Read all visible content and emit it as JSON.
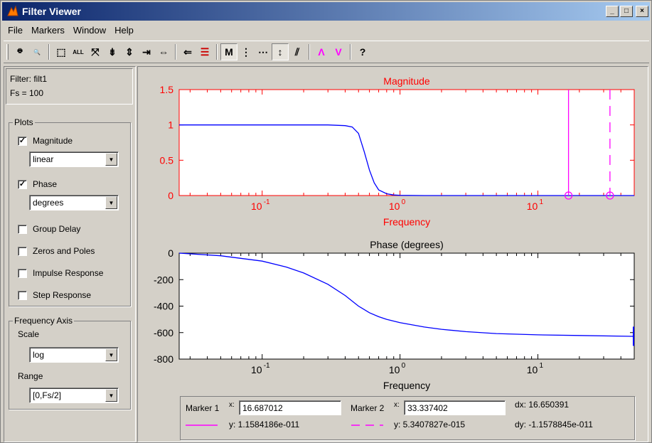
{
  "window": {
    "title": "Filter Viewer",
    "minimize": "_",
    "maximize": "□",
    "close": "×"
  },
  "menu": [
    "File",
    "Markers",
    "Window",
    "Help"
  ],
  "toolbar": {
    "tools": [
      {
        "id": "print-icon",
        "glyph": "🖶",
        "pressed": false
      },
      {
        "id": "print-preview-icon",
        "glyph": "🔍",
        "pressed": false
      },
      {
        "sep": true
      },
      {
        "id": "zoom-box-icon",
        "glyph": "⬚",
        "pressed": false
      },
      {
        "id": "zoom-all-icon",
        "glyph": "ALL",
        "pressed": false
      },
      {
        "id": "zoom-out-icon",
        "glyph": "⤧",
        "pressed": false
      },
      {
        "id": "zoom-y-in-icon",
        "glyph": "⇟",
        "pressed": false
      },
      {
        "id": "zoom-y-out-icon",
        "glyph": "⇕",
        "pressed": false
      },
      {
        "id": "zoom-x-in-icon",
        "glyph": "⇥",
        "pressed": false
      },
      {
        "id": "zoom-x-out-icon",
        "glyph": "⇔",
        "pressed": false
      },
      {
        "sep": true
      },
      {
        "id": "pass-band-icon",
        "glyph": "⇐",
        "pressed": false
      },
      {
        "id": "line-style-icon",
        "glyph": "☰",
        "pressed": false
      },
      {
        "sep": true
      },
      {
        "id": "markers-on-icon",
        "glyph": "M",
        "pressed": true
      },
      {
        "id": "vertical-markers-icon",
        "glyph": "⋮",
        "pressed": false
      },
      {
        "id": "horizontal-markers-icon",
        "glyph": "⋯",
        "pressed": false
      },
      {
        "id": "track-marker-icon",
        "glyph": "↕",
        "pressed": true
      },
      {
        "id": "slope-marker-icon",
        "glyph": "⫽",
        "pressed": false
      },
      {
        "sep": true
      },
      {
        "id": "peaks-icon",
        "glyph": "Λ",
        "pressed": false
      },
      {
        "id": "valleys-icon",
        "glyph": "V",
        "pressed": false
      },
      {
        "sep": true
      },
      {
        "id": "whats-this-help-icon",
        "glyph": "?",
        "pressed": false
      }
    ]
  },
  "filter": {
    "label": "Filter: filt1",
    "fs": "Fs = 100"
  },
  "plots": {
    "title": "Plots",
    "magnitude": {
      "label": "Magnitude",
      "checked": true,
      "scale": "linear"
    },
    "phase": {
      "label": "Phase",
      "checked": true,
      "units": "degrees"
    },
    "group_delay": {
      "label": "Group Delay",
      "checked": false
    },
    "zeros_poles": {
      "label": "Zeros and Poles",
      "checked": false
    },
    "impulse": {
      "label": "Impulse Response",
      "checked": false
    },
    "step": {
      "label": "Step Response",
      "checked": false
    }
  },
  "freq_axis": {
    "title": "Frequency Axis",
    "scale_label": "Scale",
    "scale": "log",
    "range_label": "Range",
    "range": "[0,Fs/2]"
  },
  "markers": {
    "m1_label": "Marker 1",
    "m2_label": "Marker 2",
    "x_label": "x:",
    "m1_x": "16.687012",
    "m2_x": "33.337402",
    "m1_y": "y: 1.1584186e-011",
    "m2_y": "y: 5.3407827e-015",
    "dx": "dx: 16.650391",
    "dy": "dy: -1.1578845e-011",
    "m1_color": "#ff00ff",
    "m2_color": "#ff00ff"
  },
  "chart_data": [
    {
      "type": "line",
      "title": "Magnitude",
      "xlabel": "Frequency",
      "ylabel": "",
      "xscale": "log",
      "xlim": [
        0.025,
        50
      ],
      "ylim": [
        0,
        1.5
      ],
      "yticks": [
        0,
        0.5,
        1,
        1.5
      ],
      "yticklabels": [
        "0",
        "0.5",
        "1",
        "1.5"
      ],
      "xtick_labels": [
        {
          "v": 0.1,
          "base": "10",
          "exp": "-1"
        },
        {
          "v": 1,
          "base": "10",
          "exp": "0"
        },
        {
          "v": 10,
          "base": "10",
          "exp": "1"
        }
      ],
      "axis_color": "#ff0000",
      "series": [
        {
          "color": "#0000ff",
          "x": [
            0.025,
            0.05,
            0.1,
            0.2,
            0.3,
            0.4,
            0.45,
            0.5,
            0.55,
            0.6,
            0.65,
            0.7,
            0.8,
            0.9,
            1.0,
            1.5,
            3,
            10,
            50
          ],
          "y": [
            1.0,
            1.0,
            1.0,
            1.0,
            1.0,
            0.99,
            0.97,
            0.88,
            0.62,
            0.36,
            0.18,
            0.08,
            0.025,
            0.008,
            0.003,
            0.0,
            0.0,
            0.0,
            0.0
          ]
        }
      ],
      "markers": [
        {
          "x": 16.687012,
          "y": 0,
          "style": "solid",
          "color": "#ff00ff"
        },
        {
          "x": 33.337402,
          "y": 0,
          "style": "dashed",
          "color": "#ff00ff"
        }
      ]
    },
    {
      "type": "line",
      "title": "Phase (degrees)",
      "xlabel": "Frequency",
      "ylabel": "",
      "xscale": "log",
      "xlim": [
        0.025,
        50
      ],
      "ylim": [
        -800,
        0
      ],
      "yticks": [
        0,
        -200,
        -400,
        -600,
        -800
      ],
      "yticklabels": [
        "0",
        "-200",
        "-400",
        "-600",
        "-800"
      ],
      "xtick_labels": [
        {
          "v": 0.1,
          "base": "10",
          "exp": "-1"
        },
        {
          "v": 1,
          "base": "10",
          "exp": "0"
        },
        {
          "v": 10,
          "base": "10",
          "exp": "1"
        }
      ],
      "axis_color": "#000000",
      "series": [
        {
          "color": "#0000ff",
          "x": [
            0.025,
            0.05,
            0.1,
            0.15,
            0.2,
            0.3,
            0.4,
            0.5,
            0.6,
            0.7,
            0.8,
            1.0,
            1.5,
            2,
            3,
            5,
            10,
            20,
            50
          ],
          "y": [
            0,
            -20,
            -60,
            -105,
            -150,
            -235,
            -320,
            -400,
            -450,
            -480,
            -500,
            -525,
            -558,
            -575,
            -593,
            -607,
            -617,
            -622,
            -628
          ]
        }
      ]
    }
  ]
}
